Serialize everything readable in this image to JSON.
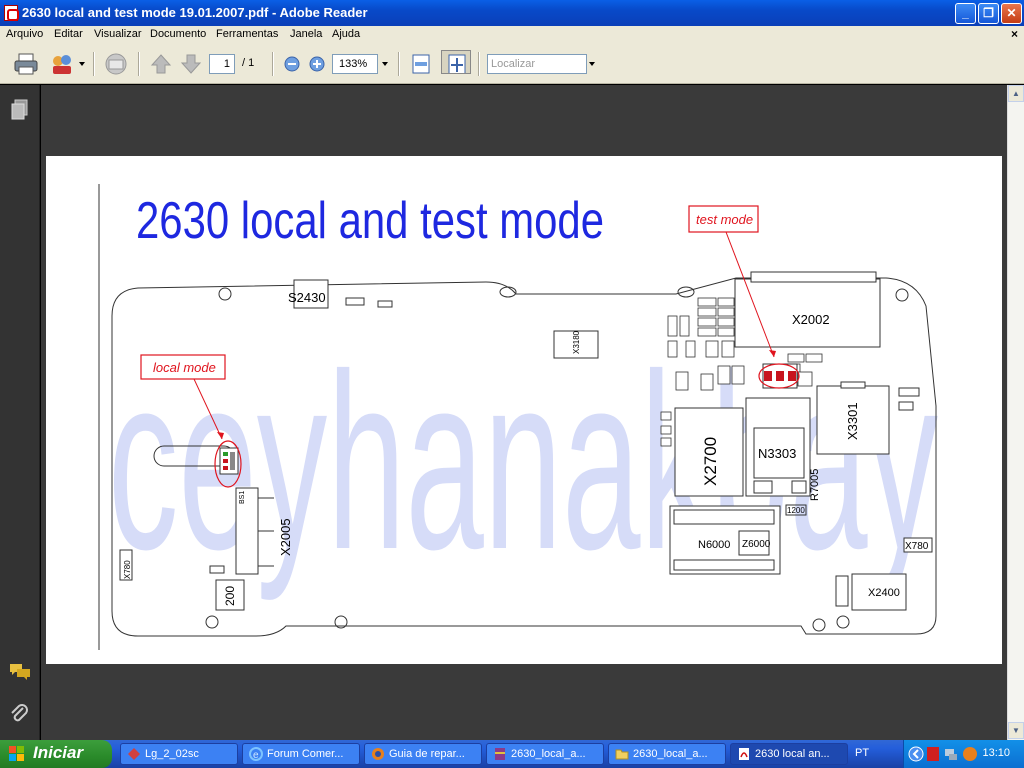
{
  "window": {
    "title": "2630 local and test mode 19.01.2007.pdf - Adobe Reader",
    "minimize": "_",
    "maximize": "❐",
    "close": "✕"
  },
  "menu": {
    "items": [
      "Arquivo",
      "Editar",
      "Visualizar",
      "Documento",
      "Ferramentas",
      "Janela",
      "Ajuda"
    ],
    "doc_close": "×"
  },
  "toolbar": {
    "page_current": "1",
    "page_total": "/ 1",
    "zoom": "133%",
    "find_placeholder": "Localizar"
  },
  "document": {
    "heading": "2630 local and test mode",
    "watermark": "ceyhanakbay",
    "callout_local": "local mode",
    "callout_test": "test mode",
    "components": {
      "s2430": "S2430",
      "x2002": "X2002",
      "x3180": "X3180",
      "x2700": "X2700",
      "n3303": "N3303",
      "x3301": "X3301",
      "x2005": "X2005",
      "n6000": "N6000",
      "z6000": "Z6000",
      "x2400": "X2400",
      "x7800a": "X780",
      "x7800b": "X780",
      "r2005": "R7005",
      "bs1": "BS1",
      "c200": "200",
      "x1200": "1200"
    },
    "accent": "#1e28e0",
    "callout_color": "#e0141e",
    "watermark_color": "#d6dcf8"
  },
  "taskbar": {
    "start_label": "Iniciar",
    "buttons": [
      {
        "label": "Lg_2_02sc",
        "icon": "app-icon"
      },
      {
        "label": "Forum Comer...",
        "icon": "ie-icon"
      },
      {
        "label": "Guia de repar...",
        "icon": "firefox-icon"
      },
      {
        "label": "2630_local_a...",
        "icon": "winrar-icon"
      },
      {
        "label": "2630_local_a...",
        "icon": "folder-icon"
      },
      {
        "label": "2630 local an...",
        "icon": "pdf-icon"
      }
    ],
    "language": "PT",
    "clock": "13:10"
  }
}
